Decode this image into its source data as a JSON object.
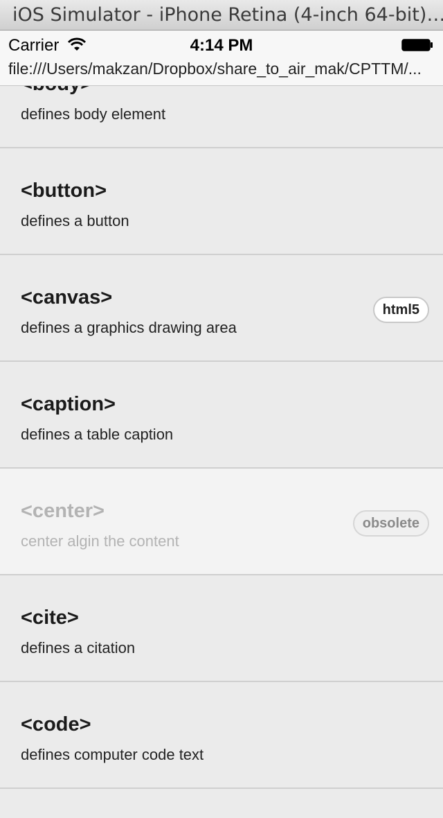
{
  "window": {
    "title": "iOS Simulator - iPhone Retina (4-inch 64-bit)…"
  },
  "status": {
    "carrier": "Carrier",
    "time": "4:14 PM"
  },
  "browser": {
    "url": "file:///Users/makzan/Dropbox/share_to_air_mak/CPTTM/..."
  },
  "items": [
    {
      "tag": "<body>",
      "desc": "defines body element",
      "badge": null,
      "dim": false
    },
    {
      "tag": "<button>",
      "desc": "defines a button",
      "badge": null,
      "dim": false
    },
    {
      "tag": "<canvas>",
      "desc": "defines a graphics drawing area",
      "badge": "html5",
      "dim": false
    },
    {
      "tag": "<caption>",
      "desc": "defines a table caption",
      "badge": null,
      "dim": false
    },
    {
      "tag": "<center>",
      "desc": "center algin the content",
      "badge": "obsolete",
      "dim": true
    },
    {
      "tag": "<cite>",
      "desc": "defines a citation",
      "badge": null,
      "dim": false
    },
    {
      "tag": "<code>",
      "desc": "defines computer code text",
      "badge": null,
      "dim": false
    }
  ]
}
